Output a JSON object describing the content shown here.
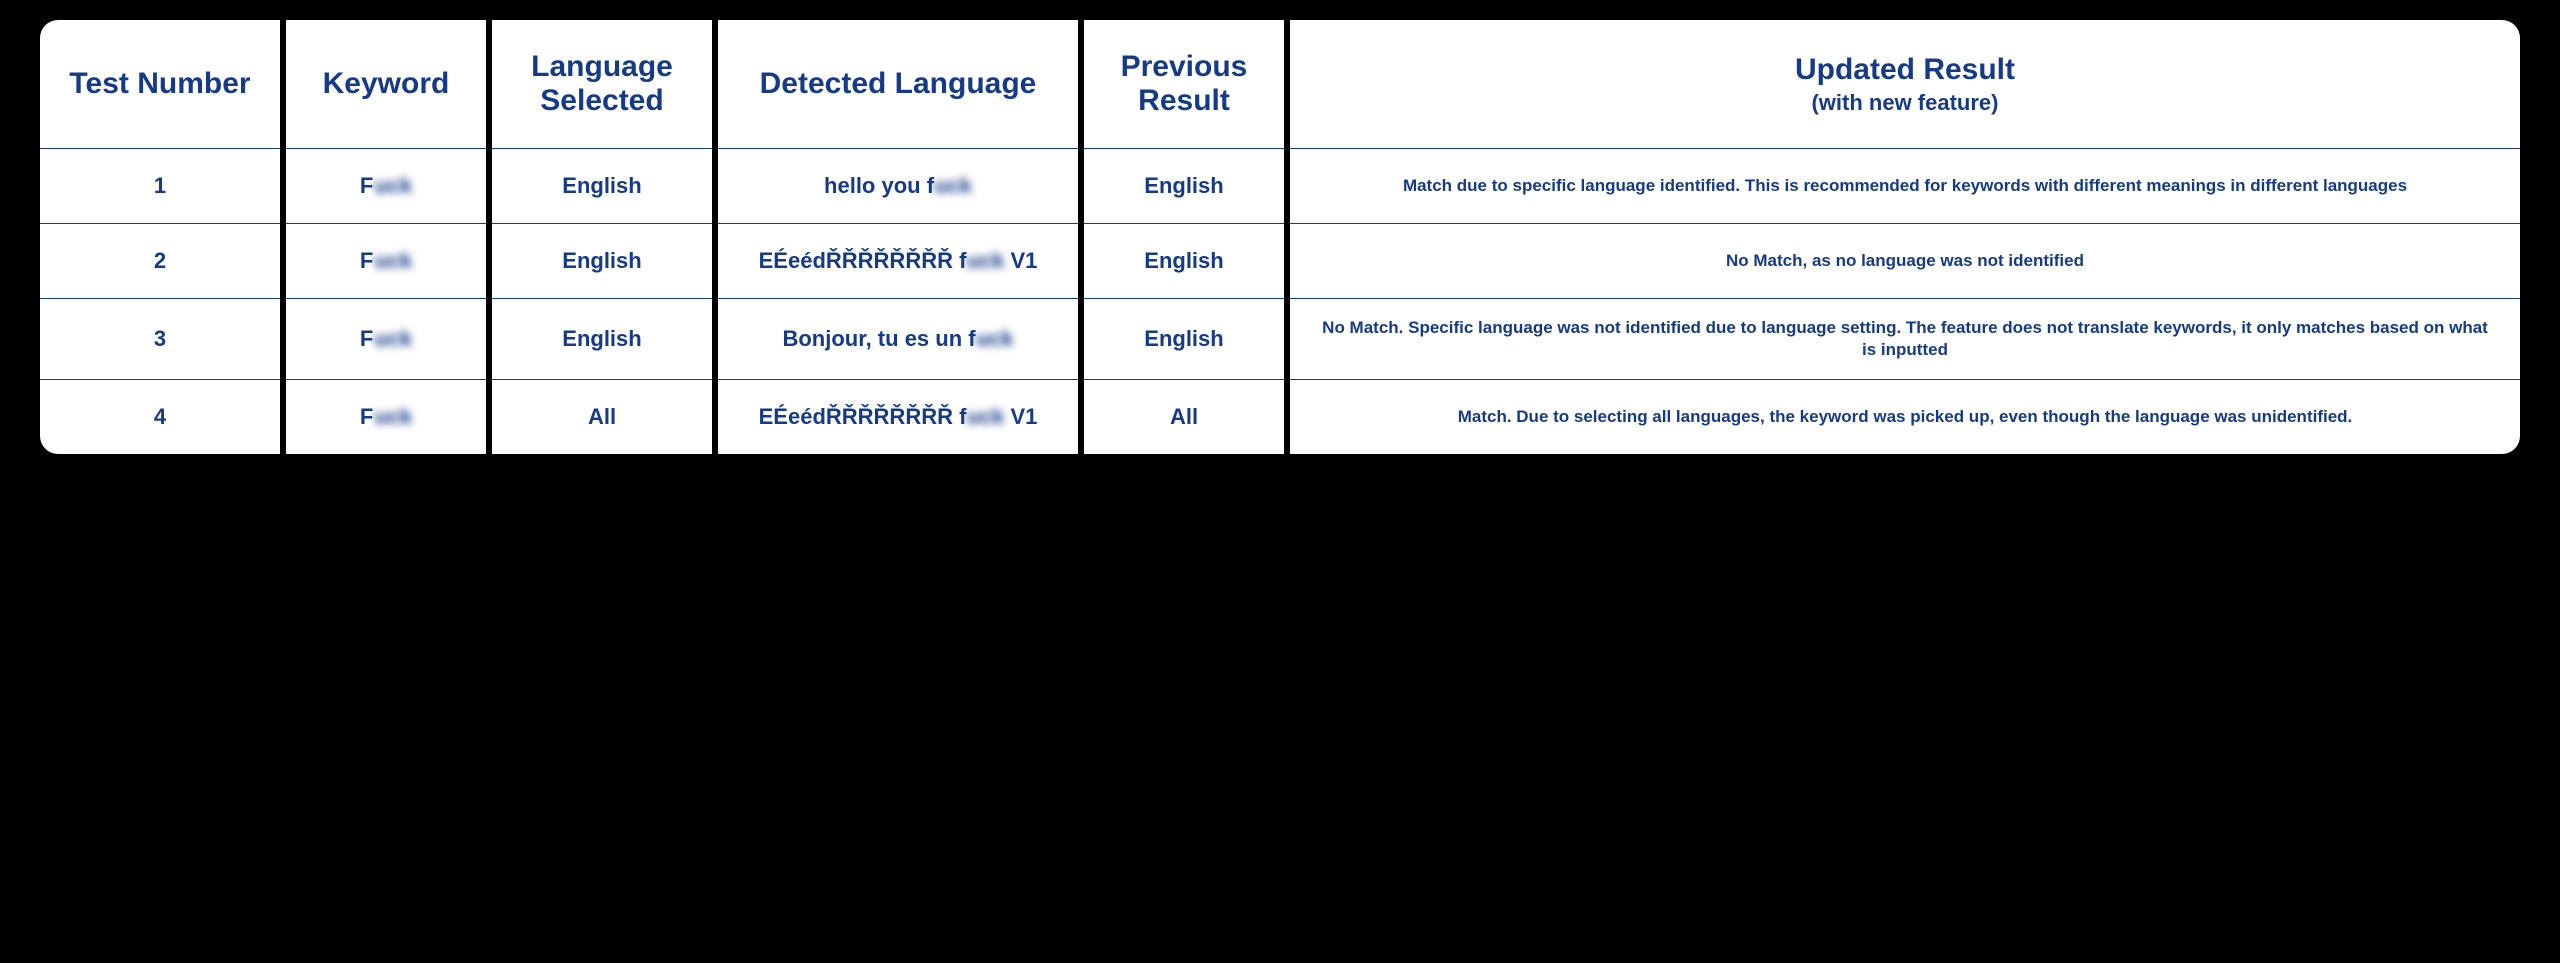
{
  "headers": {
    "test_number": "Test Number",
    "keyword": "Keyword",
    "language_selected": "Language Selected",
    "detected_language": "Detected Language",
    "previous_result": "Previous Result",
    "updated_result": "Updated Result",
    "updated_result_sub": "(with new feature)"
  },
  "rows": [
    {
      "num": "1",
      "kw_clear": "F",
      "kw_blur": "uck",
      "lang_sel": "English",
      "det_pre": "hello you f",
      "det_blur": "uck",
      "det_post": "",
      "prev": "English",
      "updated": "Match due to specific language identified. This is recommended for keywords with different meanings in different languages"
    },
    {
      "num": "2",
      "kw_clear": "F",
      "kw_blur": "uck",
      "lang_sel": "English",
      "det_pre": "EÉeédŘŘŘŘŘŘŘŘ f",
      "det_blur": "uck",
      "det_post": " V1",
      "prev": "English",
      "updated": "No Match, as no language was not identified"
    },
    {
      "num": "3",
      "kw_clear": "F",
      "kw_blur": "uck",
      "lang_sel": "English",
      "det_pre": "Bonjour, tu es un f",
      "det_blur": "uck",
      "det_post": "",
      "prev": "English",
      "updated": "No Match. Specific language was not identified due to language setting. The feature does not translate keywords, it only matches based on what is inputted"
    },
    {
      "num": "4",
      "kw_clear": "F",
      "kw_blur": "uck",
      "lang_sel": "All",
      "det_pre": "EÉeédŘŘŘŘŘŘŘŘ f",
      "det_blur": "uck",
      "det_post": " V1",
      "prev": "All",
      "updated": "Match. Due to selecting all languages, the keyword was picked up, even though the language was unidentified."
    }
  ]
}
